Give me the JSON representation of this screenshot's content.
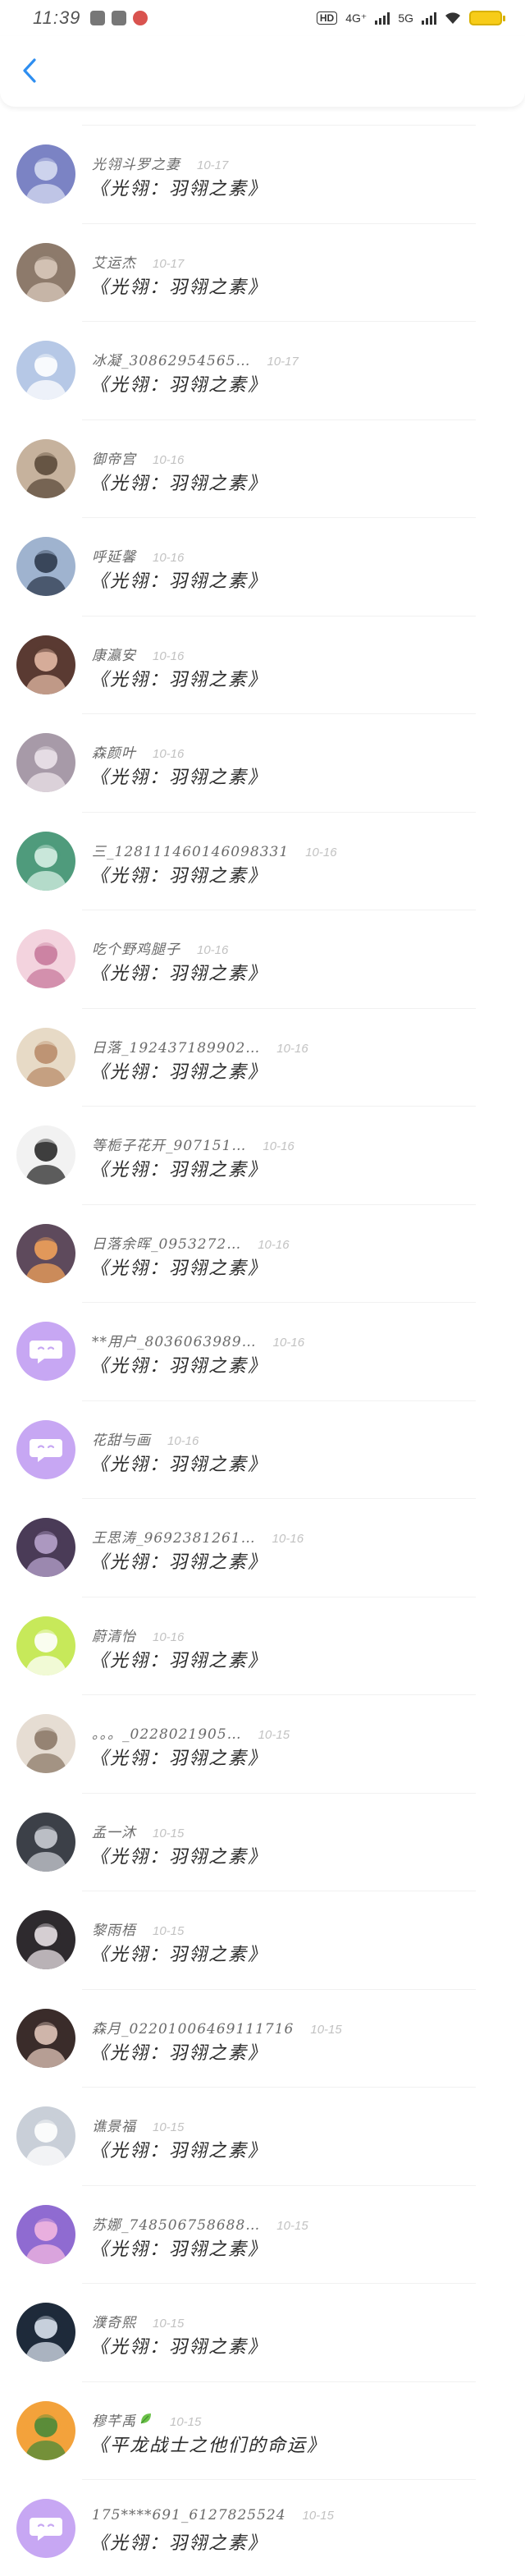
{
  "status_bar": {
    "time": "11:39",
    "hd": "HD",
    "network_1": "4G⁺",
    "network_2": "5G"
  },
  "colors": {
    "accent": "#2e8ef0",
    "default_avatar": "#c7a7f3",
    "battery": "#f7cc19"
  },
  "comments": [
    {
      "user": "光翎斗罗之妻",
      "date": "10-17",
      "text": "《光翎：羽翎之素》",
      "avatar": {
        "bg": "#7b83c4",
        "fg": "#d6dbf2",
        "icon": "anime-girl-avatar"
      }
    },
    {
      "user": "艾运杰",
      "date": "10-17",
      "text": "《光翎：羽翎之素》",
      "avatar": {
        "bg": "#8d7a6b",
        "fg": "#d9c9bb",
        "icon": "couple-photo-avatar"
      }
    },
    {
      "user": "冰凝_30862954565…",
      "date": "10-17",
      "text": "《光翎：羽翎之素》",
      "avatar": {
        "bg": "#b6c8e6",
        "fg": "#ffffff",
        "icon": "snow-girl-avatar"
      }
    },
    {
      "user": "御帝宫",
      "date": "10-16",
      "text": "《光翎：羽翎之素》",
      "avatar": {
        "bg": "#c6b29d",
        "fg": "#5b4a3b",
        "icon": "figure-avatar"
      }
    },
    {
      "user": "呼延馨",
      "date": "10-16",
      "text": "《光翎：羽翎之素》",
      "avatar": {
        "bg": "#9fb3cf",
        "fg": "#2d3a4d",
        "icon": "bird-avatar"
      }
    },
    {
      "user": "康瀛安",
      "date": "10-16",
      "text": "《光翎：羽翎之素》",
      "avatar": {
        "bg": "#5a3a32",
        "fg": "#e3b9a4",
        "icon": "portrait-avatar"
      }
    },
    {
      "user": "森颜叶",
      "date": "10-16",
      "text": "《光翎：羽翎之素》",
      "avatar": {
        "bg": "#a79aa8",
        "fg": "#ece3ea",
        "icon": "anime-girl-avatar"
      }
    },
    {
      "user": "三_128111460146098331",
      "date": "10-16",
      "text": "《光翎：羽翎之素》",
      "avatar": {
        "bg": "#4f9b7c",
        "fg": "#d6f0e4",
        "icon": "landscape-avatar"
      }
    },
    {
      "user": "吃个野鸡腿子",
      "date": "10-16",
      "text": "《光翎：羽翎之素》",
      "avatar": {
        "bg": "#f3d3de",
        "fg": "#c87a9c",
        "icon": "anime-girl-avatar"
      }
    },
    {
      "user": "日落_192437189902…",
      "date": "10-16",
      "text": "《光翎：羽翎之素》",
      "avatar": {
        "bg": "#e7dac6",
        "fg": "#b98c6a",
        "icon": "floral-avatar"
      }
    },
    {
      "user": "等栀子花开_907151…",
      "date": "10-16",
      "text": "《光翎：羽翎之素》",
      "avatar": {
        "bg": "#f2f2f2",
        "fg": "#2a2a2a",
        "icon": "chibi-avatar"
      }
    },
    {
      "user": "日落余晖_0953272…",
      "date": "10-16",
      "text": "《光翎：羽翎之素》",
      "avatar": {
        "bg": "#5e4a5c",
        "fg": "#f0a15a",
        "icon": "sunset-avatar"
      }
    },
    {
      "user": "**用户_8036063989…",
      "date": "10-16",
      "text": "《光翎：羽翎之素》",
      "avatar": {
        "bg": "#c7a7f3",
        "fg": "#ffffff",
        "icon": "default-avatar"
      }
    },
    {
      "user": "花甜与画",
      "date": "10-16",
      "text": "《光翎：羽翎之素》",
      "avatar": {
        "bg": "#c7a7f3",
        "fg": "#ffffff",
        "icon": "default-avatar"
      }
    },
    {
      "user": "王思涛_9692381261…",
      "date": "10-16",
      "text": "《光翎：羽翎之素》",
      "avatar": {
        "bg": "#4a3b57",
        "fg": "#b7a3cc",
        "icon": "dark-anime-avatar"
      }
    },
    {
      "user": "蔚清怡",
      "date": "10-16",
      "text": "《光翎：羽翎之素》",
      "avatar": {
        "bg": "#c7e95a",
        "fg": "#ffffff",
        "icon": "green-text-avatar"
      }
    },
    {
      "user": "。。。_0228021905…",
      "date": "10-15",
      "text": "《光翎：羽翎之素》",
      "avatar": {
        "bg": "#e6ddd3",
        "fg": "#8c7968",
        "icon": "anime-girl-avatar"
      }
    },
    {
      "user": "孟一沐",
      "date": "10-15",
      "text": "《光翎：羽翎之素》",
      "avatar": {
        "bg": "#3c4048",
        "fg": "#c9ccd3",
        "icon": "anime-boy-avatar"
      }
    },
    {
      "user": "黎雨梧",
      "date": "10-15",
      "text": "《光翎：羽翎之素》",
      "avatar": {
        "bg": "#2e2a2e",
        "fg": "#e8e0e4",
        "icon": "portrait-avatar"
      }
    },
    {
      "user": "森月_02201006469111716",
      "date": "10-15",
      "text": "《光翎：羽翎之素》",
      "avatar": {
        "bg": "#3a2c2a",
        "fg": "#e0c4b8",
        "icon": "portrait-avatar"
      }
    },
    {
      "user": "谯景福",
      "date": "10-15",
      "text": "《光翎：羽翎之素》",
      "avatar": {
        "bg": "#c9cfd8",
        "fg": "#ffffff",
        "icon": "anime-boy-avatar"
      }
    },
    {
      "user": "苏娜_748506758688…",
      "date": "10-15",
      "text": "《光翎：羽翎之素》",
      "avatar": {
        "bg": "#8f6bd1",
        "fg": "#f3b7e0",
        "icon": "anime-girl-avatar"
      }
    },
    {
      "user": "濮奇熙",
      "date": "10-15",
      "text": "《光翎：羽翎之素》",
      "avatar": {
        "bg": "#1e2a3a",
        "fg": "#d9e2ee",
        "icon": "car-avatar"
      }
    },
    {
      "user": "穆芊禹",
      "date": "10-15",
      "text": "《平龙战士之他们的命运》",
      "avatar": {
        "bg": "#f3a23b",
        "fg": "#4a8a3a",
        "icon": "cartoon-avatar"
      },
      "badge": "leaf-icon"
    },
    {
      "user": "175****691_6127825524",
      "date": "10-15",
      "text": "《光翎：羽翎之素》",
      "avatar": {
        "bg": "#c7a7f3",
        "fg": "#ffffff",
        "icon": "default-avatar"
      }
    }
  ]
}
